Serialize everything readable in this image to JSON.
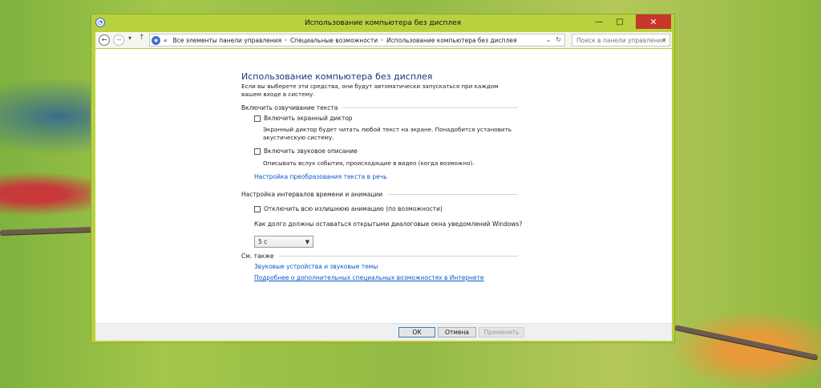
{
  "window": {
    "title": "Использование компьютера без дисплея",
    "controls": {
      "minimize": "—",
      "maximize": "□",
      "close": "✕"
    }
  },
  "nav": {
    "back": "←",
    "forward": "→",
    "recent": "▾",
    "up": "↑",
    "breadcrumb_prefix": "«",
    "breadcrumbs": [
      "Все элементы панели управления",
      "Специальные возможности",
      "Использование компьютера без дисплея"
    ],
    "crumb_sep": "›",
    "dropdown": "⌄",
    "refresh": "↻",
    "search_placeholder": "Поиск в панели управления",
    "search_glyph": "⌕"
  },
  "main": {
    "title": "Использование компьютера без дисплея",
    "intro": "Если вы выберете эти средства, они будут автоматически запускаться при каждом вашем входе в систему.",
    "section_speech": "Включить озвучивание текста",
    "narrator_label": "Включить экранный диктор",
    "narrator_desc": "Экранный диктор будет читать любой текст на экране. Понадобится установить акустическую систему.",
    "audio_desc_label": "Включить звуковое описание",
    "audio_desc_desc": "Описывать вслух события, происходящие в видео (когда возможно).",
    "tts_link": "Настройка преобразования текста в речь",
    "section_timing": "Настройка интервалов времени и анимации",
    "animations_label": "Отключить всю излишнюю анимацию (по возможности)",
    "notify_question": "Как долго должны оставаться открытыми диалоговые окна уведомлений Windows?",
    "notify_value": "5 с",
    "section_see_also": "См. также",
    "link_sound": "Звуковые устройства и звуковые темы",
    "link_more": "Подробнее о дополнительных специальных возможностях в Интернете"
  },
  "footer": {
    "ok": "ОК",
    "cancel": "Отмена",
    "apply": "Применить"
  },
  "checkboxes": {
    "narrator": false,
    "audio_description": false,
    "animations": false
  },
  "colors": {
    "frame": "#b8d13e",
    "close": "#c7362b",
    "title_blue": "#1e3287",
    "link": "#0a58c8"
  }
}
